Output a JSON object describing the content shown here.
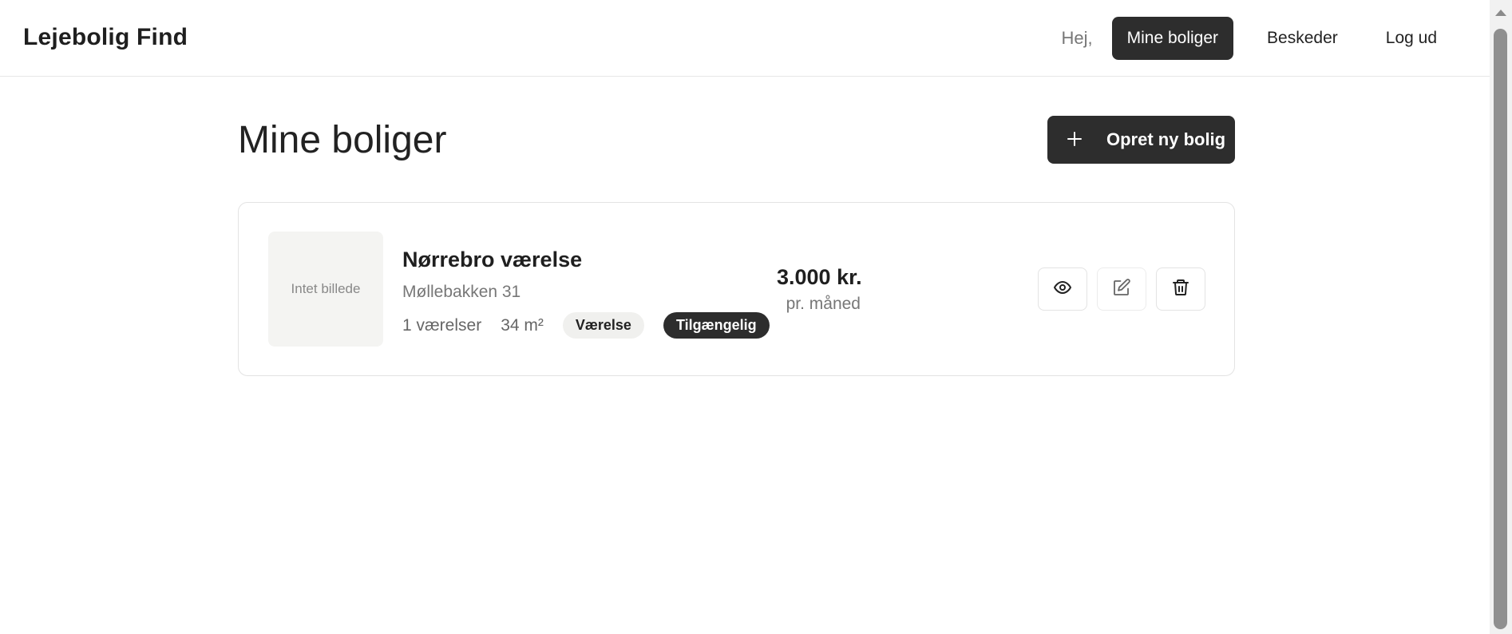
{
  "header": {
    "brand": "Lejebolig Find",
    "greeting": "Hej,",
    "nav": {
      "my_listings": "Mine boliger",
      "messages": "Beskeder",
      "logout": "Log ud"
    },
    "active_nav": "my_listings"
  },
  "main": {
    "title": "Mine boliger",
    "create_button": {
      "icon": "plus-icon",
      "label": "Opret ny bolig"
    },
    "listings": [
      {
        "image_placeholder": "Intet billede",
        "title": "Nørrebro værelse",
        "address": "Møllebakken 31",
        "rooms": "1 værelser",
        "size": "34 m²",
        "type_badge": "Værelse",
        "status_badge": "Tilgængelig",
        "price": "3.000 kr.",
        "period": "pr. måned",
        "actions": [
          "eye-icon",
          "edit-icon",
          "trash-icon"
        ]
      }
    ]
  },
  "colors": {
    "primary_dark": "#2d2d2d",
    "muted_text": "#777777",
    "border": "#e3e3e3",
    "placeholder_bg": "#f4f4f2"
  }
}
